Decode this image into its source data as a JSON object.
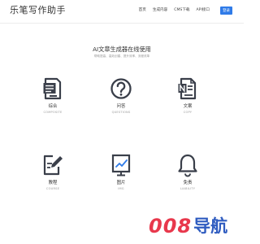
{
  "header": {
    "logo": "乐笔写作助手",
    "nav": [
      "首页",
      "生成内容",
      "CMS下载",
      "API接口"
    ],
    "login_label": "登录"
  },
  "hero": {
    "title": "AI文章生成器在线使用",
    "subtitle": "帮助提高、高效创建、提升效率、流程改革"
  },
  "cards": [
    {
      "title": "综合",
      "subtitle": "COMPOSITE",
      "icon": "document-list-icon"
    },
    {
      "title": "问答",
      "subtitle": "QUESTIONS",
      "icon": "question-mark-icon"
    },
    {
      "title": "文案",
      "subtitle": "COPY",
      "icon": "text-document-icon"
    },
    {
      "title": "教程",
      "subtitle": "COURSE",
      "icon": "edit-document-icon"
    },
    {
      "title": "图片",
      "subtitle": "IMG",
      "icon": "line-chart-board-icon"
    },
    {
      "title": "免责",
      "subtitle": "LIABILITY",
      "icon": "bell-icon"
    }
  ],
  "watermark": {
    "number": "008",
    "text": "导航"
  },
  "colors": {
    "accent": "#2f7be8",
    "icon": "#3a3f4a",
    "watermark_red": "#e8384c",
    "watermark_blue": "#2f5cc0"
  }
}
